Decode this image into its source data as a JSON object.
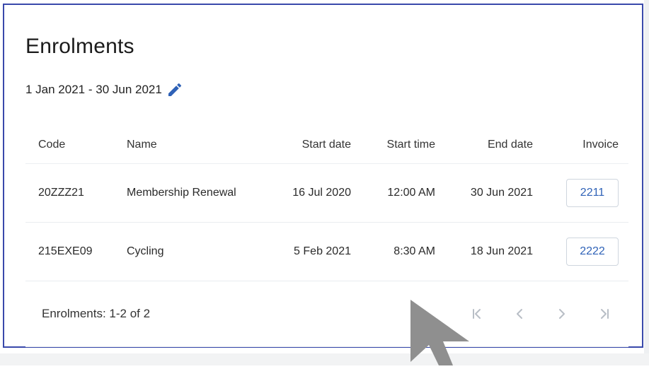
{
  "page": {
    "title": "Enrolments",
    "date_range": "1 Jan 2021 - 30 Jun 2021",
    "edit_icon": "pencil-icon"
  },
  "table": {
    "headers": {
      "code": "Code",
      "name": "Name",
      "start_date": "Start date",
      "start_time": "Start time",
      "end_date": "End date",
      "invoice": "Invoice"
    },
    "rows": [
      {
        "code": "20ZZZ21",
        "name": "Membership Renewal",
        "start_date": "16 Jul 2020",
        "start_time": "12:00 AM",
        "end_date": "30 Jun 2021",
        "invoice": "2211"
      },
      {
        "code": "215EXE09",
        "name": "Cycling",
        "start_date": "5 Feb 2021",
        "start_time": "8:30 AM",
        "end_date": "18 Jun 2021",
        "invoice": "2222"
      }
    ]
  },
  "footer": {
    "summary": "Enrolments: 1-2 of 2",
    "pager_icons": [
      "first-page-icon",
      "previous-page-icon",
      "next-page-icon",
      "last-page-icon"
    ]
  },
  "colors": {
    "frame_border": "#3949ab",
    "accent_link": "#2f62b7",
    "pager_disabled": "#b8bec6",
    "cursor": "#8f8f8f"
  }
}
